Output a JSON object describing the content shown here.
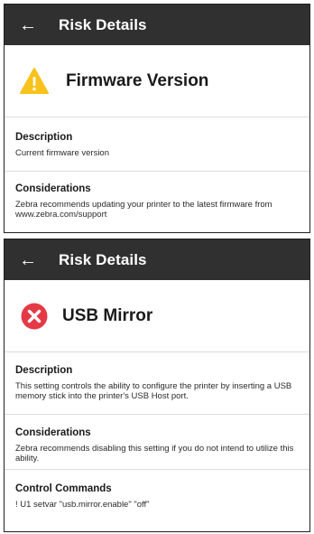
{
  "panels": [
    {
      "appbar": {
        "back_icon": "arrow-left-icon",
        "title": "Risk Details"
      },
      "risk": {
        "icon": "warning-triangle-icon",
        "icon_color": "#F7C21B",
        "title": "Firmware Version"
      },
      "sections": {
        "description": {
          "heading": "Description",
          "body": "Current firmware version"
        },
        "considerations": {
          "heading": "Considerations",
          "body_line1": "Zebra recommends updating your printer to the latest firmware from",
          "body_line2": "www.zebra.com/support"
        }
      }
    },
    {
      "appbar": {
        "back_icon": "arrow-left-icon",
        "title": "Risk Details"
      },
      "risk": {
        "icon": "error-circle-x-icon",
        "icon_color": "#E53945",
        "title": "USB Mirror"
      },
      "sections": {
        "description": {
          "heading": "Description",
          "body_line1": "This setting controls the ability to configure the printer by inserting a USB",
          "body_line2": "memory stick into the printer's USB Host port."
        },
        "considerations": {
          "heading": "Considerations",
          "body_line1": "Zebra recommends disabling this setting if you do not intend to utilize this",
          "body_line2": "ability."
        },
        "control_commands": {
          "heading": "Control Commands",
          "body": "! U1 setvar \"usb.mirror.enable\" \"off\""
        }
      }
    }
  ],
  "colors": {
    "appbar_bg": "#303030",
    "warning": "#F7C21B",
    "error": "#E53945"
  }
}
